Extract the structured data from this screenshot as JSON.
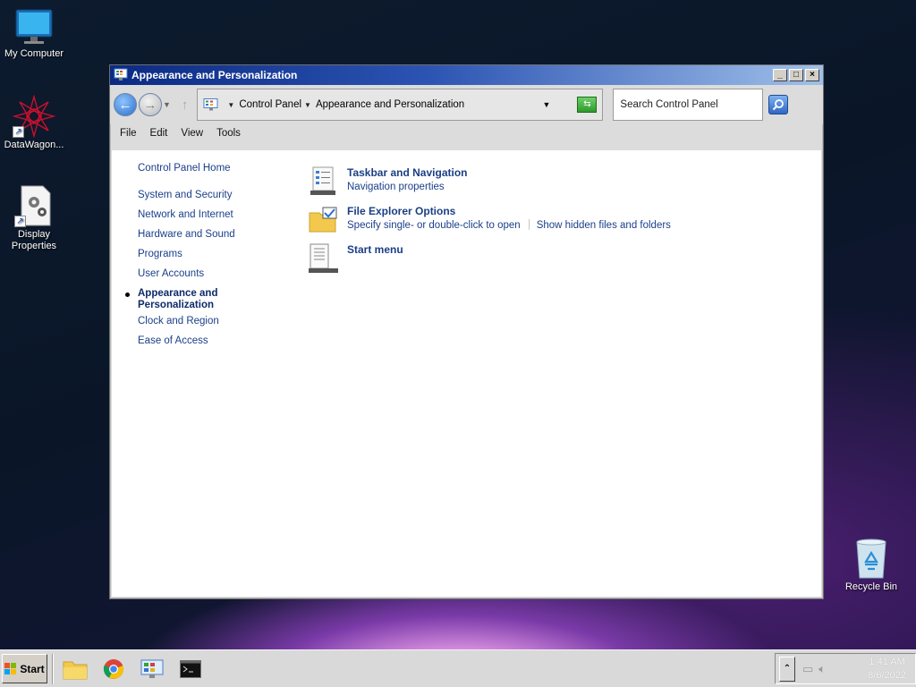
{
  "desktop": {
    "icons": [
      {
        "label": "My Computer",
        "icon": "monitor-icon"
      },
      {
        "label": "DataWagon...",
        "icon": "datawagon-icon"
      },
      {
        "label": "Display Properties",
        "icon": "display-properties-icon"
      },
      {
        "label": "Recycle Bin",
        "icon": "recycle-bin-icon"
      }
    ]
  },
  "window": {
    "title": "Appearance and Personalization",
    "controls": {
      "minimize": "_",
      "maximize": "□",
      "close": "×"
    },
    "address": {
      "crumbs": [
        "Control Panel",
        "Appearance and Personalization"
      ]
    },
    "search": {
      "placeholder": "Search Control Panel"
    },
    "menu": [
      "File",
      "Edit",
      "View",
      "Tools"
    ],
    "sidebar": {
      "home": "Control Panel Home",
      "items": [
        {
          "label": "System and Security",
          "active": false
        },
        {
          "label": "Network and Internet",
          "active": false
        },
        {
          "label": "Hardware and Sound",
          "active": false
        },
        {
          "label": "Programs",
          "active": false
        },
        {
          "label": "User Accounts",
          "active": false
        },
        {
          "label": "Appearance and Personalization",
          "active": true
        },
        {
          "label": "Clock and Region",
          "active": false
        },
        {
          "label": "Ease of Access",
          "active": false
        }
      ]
    },
    "items": [
      {
        "heading": "Taskbar and Navigation",
        "links": [
          "Navigation properties"
        ],
        "icon": "taskbar-icon"
      },
      {
        "heading": "File Explorer Options",
        "links": [
          "Specify single- or double-click to open",
          "Show hidden files and folders"
        ],
        "icon": "folder-options-icon"
      },
      {
        "heading": "Start menu",
        "links": [],
        "icon": "start-menu-icon"
      }
    ]
  },
  "taskbar": {
    "start_label": "Start",
    "apps": [
      "file-explorer-icon",
      "chrome-icon",
      "control-panel-icon",
      "terminal-icon"
    ],
    "clock": {
      "time": "1:41 AM",
      "date": "8/6/2022"
    }
  }
}
